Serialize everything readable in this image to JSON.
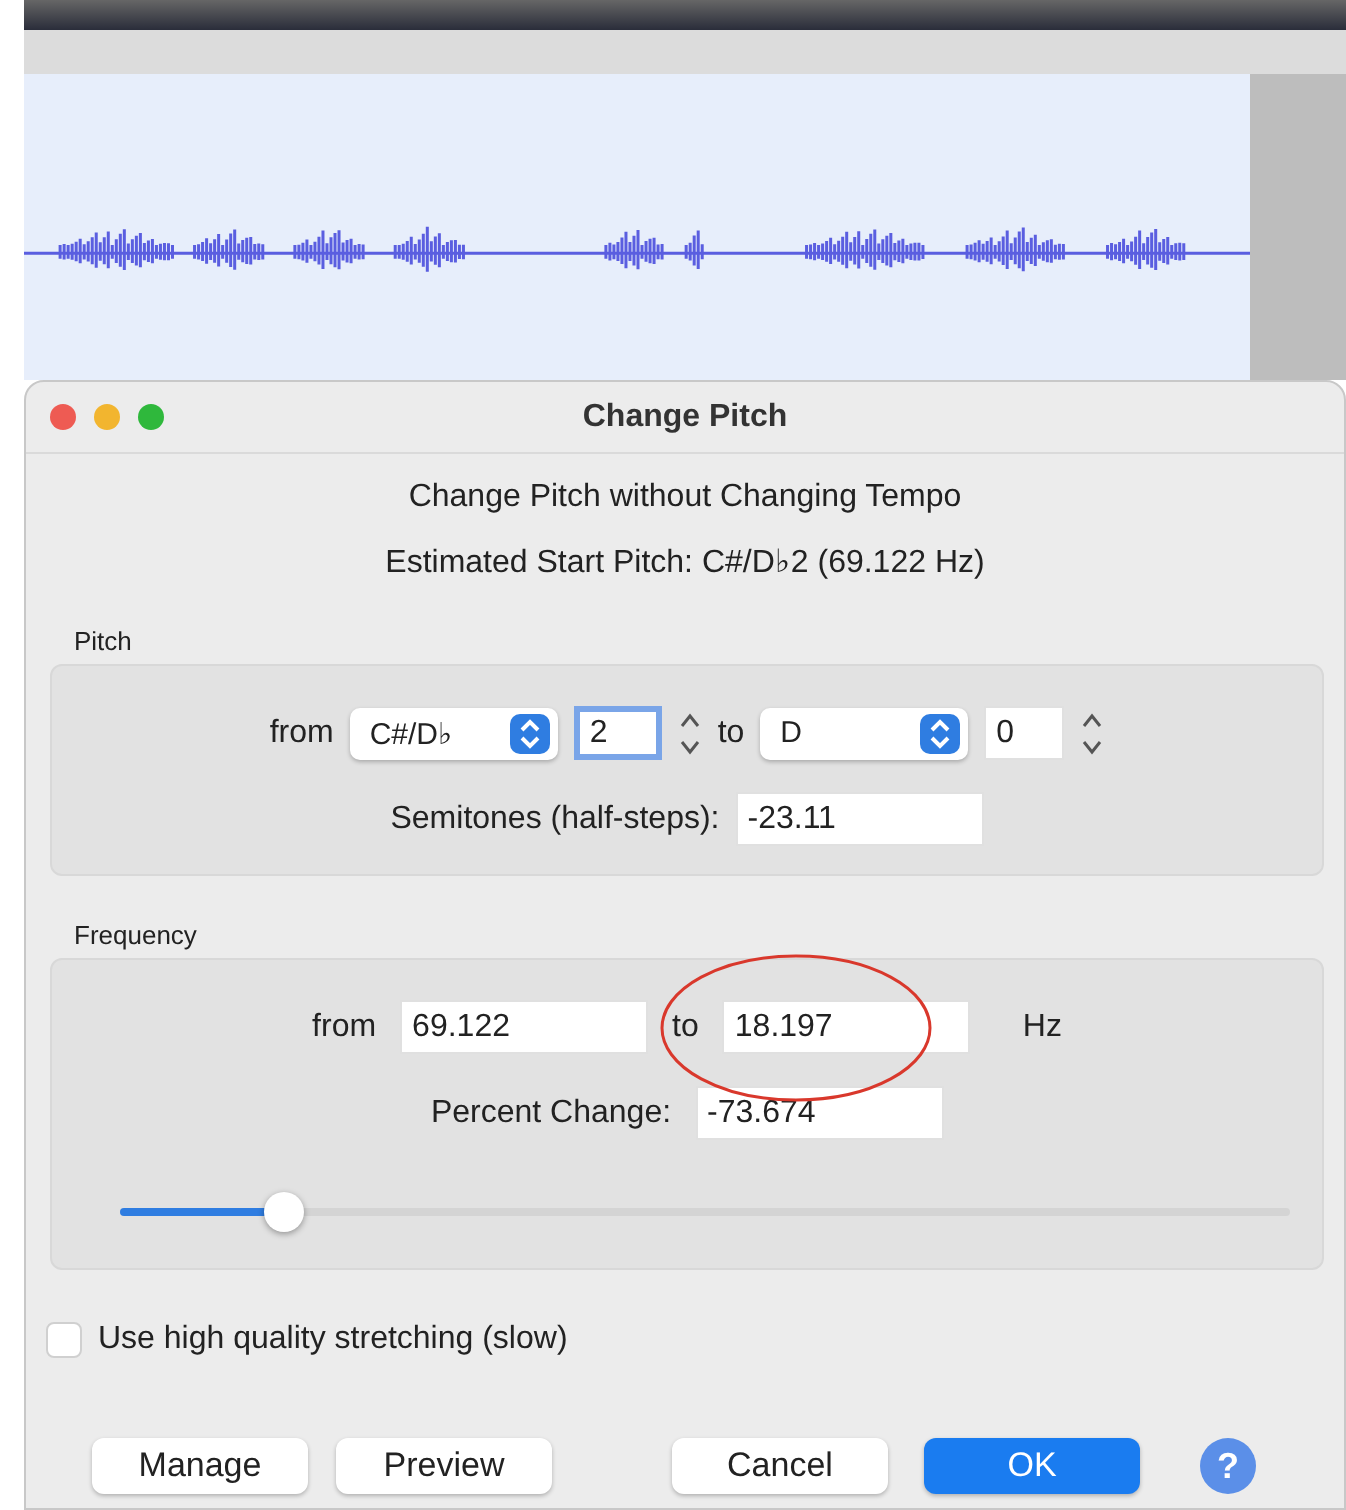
{
  "dialog": {
    "title": "Change Pitch",
    "heading": "Change Pitch without Changing Tempo",
    "estimate": "Estimated Start Pitch: C#/D♭2 (69.122 Hz)"
  },
  "pitch": {
    "label": "Pitch",
    "from_label": "from",
    "from_note": "C#/D♭",
    "from_octave": "2",
    "to_label": "to",
    "to_note": "D",
    "to_octave": "0",
    "semitones_label": "Semitones (half-steps):",
    "semitones": "-23.11"
  },
  "frequency": {
    "label": "Frequency",
    "from_label": "from",
    "from_value": "69.122",
    "to_label": "to",
    "to_value": "18.197",
    "unit": "Hz",
    "percent_label": "Percent Change:",
    "percent": "-73.674",
    "slider": {
      "level": 0.14
    }
  },
  "high_quality": {
    "label": "Use high quality stretching (slow)",
    "checked": false
  },
  "buttons": [
    {
      "label": "Manage",
      "kind": "plain"
    },
    {
      "label": "Preview",
      "kind": "plain"
    },
    {
      "label": "Cancel",
      "kind": "plain"
    },
    {
      "label": "OK",
      "kind": "default"
    },
    {
      "label": "?",
      "kind": "help"
    }
  ]
}
